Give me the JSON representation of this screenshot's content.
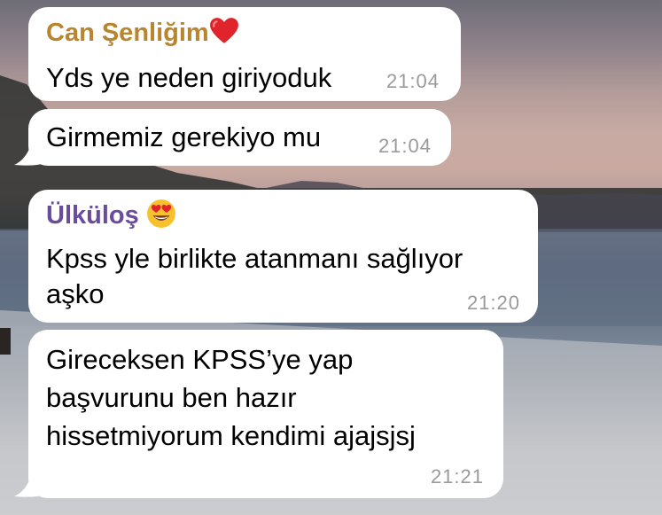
{
  "chat": {
    "messages": [
      {
        "sender": "Can Şenliğim",
        "sender_icon": "red-heart-icon",
        "sender_color": "#b8862e",
        "text": "Yds ye neden giriyoduk",
        "time": "21:04"
      },
      {
        "sender": "",
        "text": "Girmemiz gerekiyo mu",
        "time": "21:04"
      },
      {
        "sender": "Ülküloş",
        "sender_icon": "heart-eyes-emoji-icon",
        "sender_color": "#6a4c9c",
        "text": "Kpss yle birlikte atanmanı sağlıyor\naşko",
        "time": "21:20"
      },
      {
        "sender": "",
        "text": "Gireceksen KPSS’ye yap\nbaşvurunu ben hazır\nhissetmiyorum kendimi ajajsjsj",
        "time": "21:21"
      }
    ]
  },
  "colors": {
    "bubble": "#ffffff",
    "time": "#9a9a9a"
  }
}
